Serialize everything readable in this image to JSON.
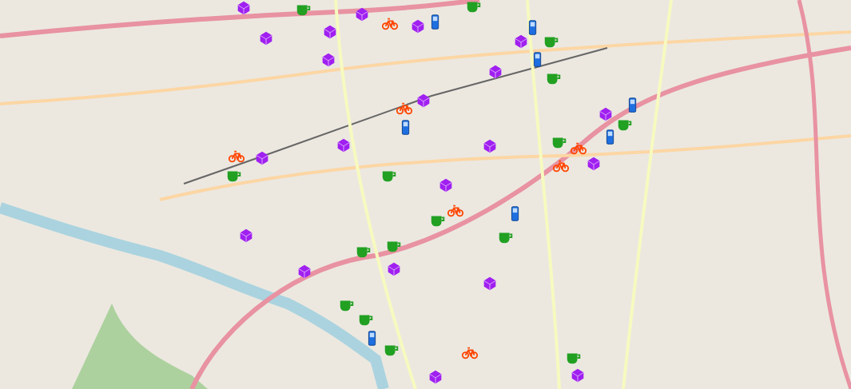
{
  "map": {
    "markers": [
      {
        "kind": "book"
      },
      {
        "kind": "book"
      },
      {
        "kind": "book"
      },
      {
        "kind": "book"
      },
      {
        "kind": "book"
      },
      {
        "kind": "book"
      },
      {
        "kind": "book"
      },
      {
        "kind": "book"
      },
      {
        "kind": "book"
      },
      {
        "kind": "book"
      },
      {
        "kind": "book"
      },
      {
        "kind": "book"
      },
      {
        "kind": "book"
      },
      {
        "kind": "book"
      },
      {
        "kind": "book"
      },
      {
        "kind": "book"
      },
      {
        "kind": "book"
      },
      {
        "kind": "book"
      },
      {
        "kind": "book"
      },
      {
        "kind": "book"
      },
      {
        "kind": "book"
      },
      {
        "kind": "cup"
      },
      {
        "kind": "cup"
      },
      {
        "kind": "cup"
      },
      {
        "kind": "cup"
      },
      {
        "kind": "cup"
      },
      {
        "kind": "cup"
      },
      {
        "kind": "cup"
      },
      {
        "kind": "cup"
      },
      {
        "kind": "cup"
      },
      {
        "kind": "cup"
      },
      {
        "kind": "cup"
      },
      {
        "kind": "cup"
      },
      {
        "kind": "cup"
      },
      {
        "kind": "cup"
      },
      {
        "kind": "cup"
      },
      {
        "kind": "cup"
      },
      {
        "kind": "bicycle"
      },
      {
        "kind": "bicycle"
      },
      {
        "kind": "bicycle"
      },
      {
        "kind": "bicycle"
      },
      {
        "kind": "bicycle"
      },
      {
        "kind": "bicycle"
      },
      {
        "kind": "bicycle"
      },
      {
        "kind": "phone"
      },
      {
        "kind": "phone"
      },
      {
        "kind": "phone"
      },
      {
        "kind": "phone"
      },
      {
        "kind": "phone"
      },
      {
        "kind": "phone"
      },
      {
        "kind": "phone"
      },
      {
        "kind": "phone"
      }
    ]
  }
}
